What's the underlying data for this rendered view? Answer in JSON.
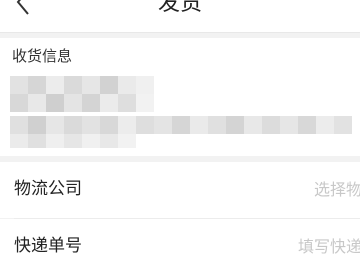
{
  "header": {
    "back_icon": "chevron-left-icon",
    "title": "发货"
  },
  "address": {
    "label": "收货信息",
    "content_state": "pixelated (obscured)"
  },
  "form": {
    "company": {
      "label": "物流公司",
      "placeholder": "选择物"
    },
    "tracking": {
      "label": "快递单号",
      "placeholder": "填写快递"
    }
  }
}
